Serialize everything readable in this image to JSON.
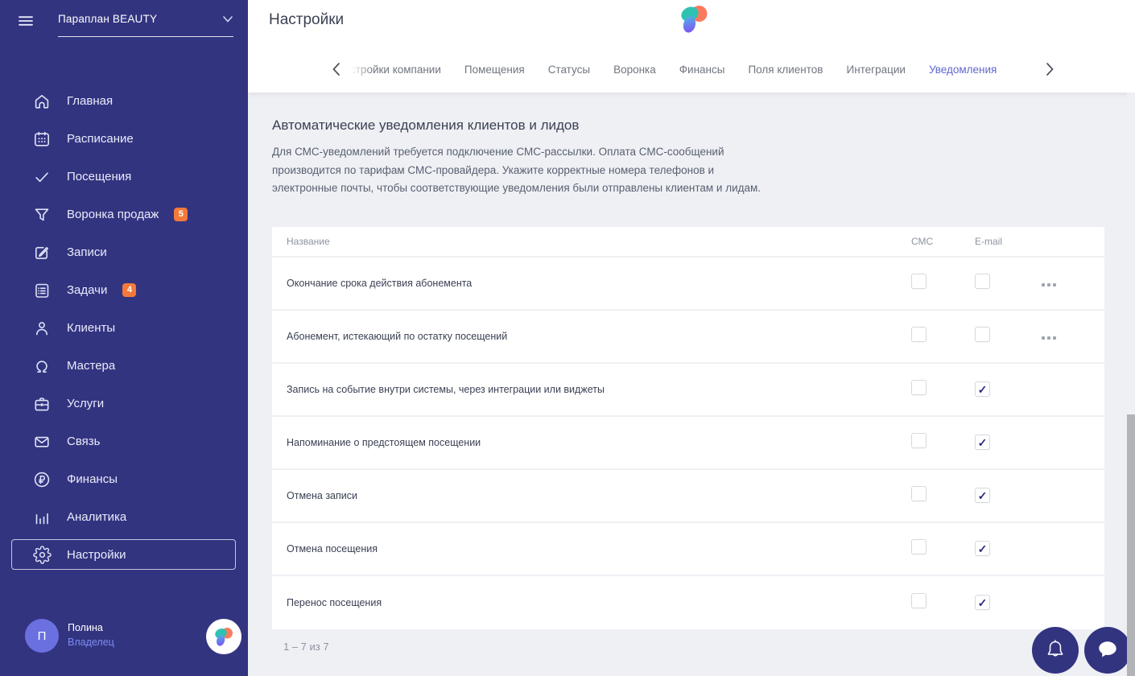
{
  "sidebar": {
    "company": "Параплан BEAUTY",
    "items": [
      {
        "key": "home",
        "icon": "home",
        "label": "Главная"
      },
      {
        "key": "schedule",
        "icon": "calendar",
        "label": "Расписание"
      },
      {
        "key": "visits",
        "icon": "check",
        "label": "Посещения"
      },
      {
        "key": "sales-funnel",
        "icon": "funnel",
        "label": "Воронка продаж",
        "badge": "5"
      },
      {
        "key": "records",
        "icon": "edit",
        "label": "Записи"
      },
      {
        "key": "tasks",
        "icon": "tasks",
        "label": "Задачи",
        "badge": "4"
      },
      {
        "key": "clients",
        "icon": "person",
        "label": "Клиенты"
      },
      {
        "key": "masters",
        "icon": "master",
        "label": "Мастера"
      },
      {
        "key": "services",
        "icon": "briefcase",
        "label": "Услуги"
      },
      {
        "key": "communication",
        "icon": "mail",
        "label": "Связь"
      },
      {
        "key": "finance",
        "icon": "ruble",
        "label": "Финансы"
      },
      {
        "key": "analytics",
        "icon": "chart",
        "label": "Аналитика"
      },
      {
        "key": "settings",
        "icon": "gear",
        "label": "Настройки",
        "active": true
      }
    ],
    "user": {
      "initial": "П",
      "name": "Полина",
      "role": "Владелец"
    }
  },
  "header": {
    "title": "Настройки"
  },
  "tabs": [
    {
      "key": "company-settings",
      "label": "стройки компании",
      "faded": true
    },
    {
      "key": "rooms",
      "label": "Помещения"
    },
    {
      "key": "statuses",
      "label": "Статусы"
    },
    {
      "key": "funnel",
      "label": "Воронка"
    },
    {
      "key": "finance",
      "label": "Финансы"
    },
    {
      "key": "client-fields",
      "label": "Поля клиентов"
    },
    {
      "key": "integrations",
      "label": "Интеграции"
    },
    {
      "key": "notifications",
      "label": "Уведомления",
      "active": true
    }
  ],
  "content": {
    "heading": "Автоматические уведомления клиентов и лидов",
    "description": "Для СМС-уведомлений требуется подключение СМС-рассылки. Оплата СМС-сообщений производится по тарифам СМС-провайдера. Укажите корректные номера телефонов и электронные почты, чтобы соответствующие уведомления были отправлены клиентам и лидам.",
    "table": {
      "columns": {
        "name": "Название",
        "sms": "СМС",
        "email": "E-mail"
      },
      "rows": [
        {
          "name": "Окончание срока действия абонемента",
          "sms": false,
          "email": false,
          "menu": true
        },
        {
          "name": "Абонемент, истекающий по остатку посещений",
          "sms": false,
          "email": false,
          "menu": true
        },
        {
          "name": "Запись на событие внутри системы, через интеграции или виджеты",
          "sms": false,
          "email": true,
          "menu": false
        },
        {
          "name": "Напоминание о предстоящем посещении",
          "sms": false,
          "email": true,
          "menu": false
        },
        {
          "name": "Отмена записи",
          "sms": false,
          "email": true,
          "menu": false
        },
        {
          "name": "Отмена посещения",
          "sms": false,
          "email": true,
          "menu": false
        },
        {
          "name": "Перенос посещения",
          "sms": false,
          "email": true,
          "menu": false
        }
      ]
    },
    "pagination": "1 – 7 из 7"
  },
  "colors": {
    "sidebar_bg": "#333480",
    "accent_tab": "#6067cd",
    "badge_orange": "#f5793b",
    "checkmark_navy": "#2b2d7e",
    "content_bg": "#eef0f4",
    "logo_teal": "#2fc2b2",
    "logo_coral": "#fb7a5e",
    "logo_blue": "#5a6ce0",
    "avatar_bg": "#6b70e0",
    "role_text": "#7d8df2"
  }
}
